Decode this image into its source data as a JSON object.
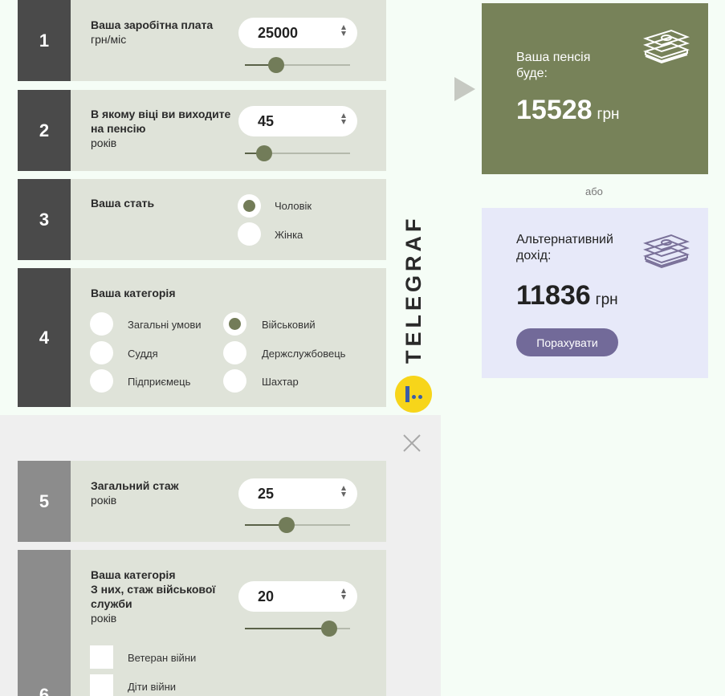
{
  "q1": {
    "num": "1",
    "title": "Ваша заробітна плата",
    "sub": "грн/міс",
    "value": "25000",
    "slider": 0.3
  },
  "q2": {
    "num": "2",
    "title1": "В якому віці ви виходите",
    "title2": "на пенсію",
    "sub": "років",
    "value": "45",
    "slider": 0.18
  },
  "q3": {
    "num": "3",
    "title": "Ваша стать",
    "options": [
      "Чоловік",
      "Жінка"
    ],
    "selected": "Чоловік"
  },
  "q4": {
    "num": "4",
    "title": "Ваша категорія",
    "options": [
      "Загальні умови",
      "Військовий",
      "Суддя",
      "Держслужбовець",
      "Підприємець",
      "Шахтар"
    ],
    "selected": "Військовий"
  },
  "q5": {
    "num": "5",
    "title": "Загальний стаж",
    "sub": "років",
    "value": "25",
    "slider": 0.4
  },
  "q6": {
    "num": "6",
    "title1": "Ваша категорія",
    "title2": "З них, стаж військової",
    "title3": "служби",
    "sub": "років",
    "value": "20",
    "slider": 0.8,
    "checks": [
      "Ветеран війни",
      "Діти війни"
    ]
  },
  "brand": "TELEGRAF",
  "pension": {
    "title1": "Ваша пенсія",
    "title2": "буде:",
    "value": "15528",
    "unit": "грн"
  },
  "or_label": "або",
  "alt": {
    "title1": "Альтернативний",
    "title2": "дохід:",
    "value": "11836",
    "unit": "грн",
    "button": "Порахувати"
  },
  "colors": {
    "pension_bg": "#778259",
    "alt_bg": "#e7e9f9",
    "accent": "#726a99",
    "brand_yellow": "#f7d51a"
  }
}
